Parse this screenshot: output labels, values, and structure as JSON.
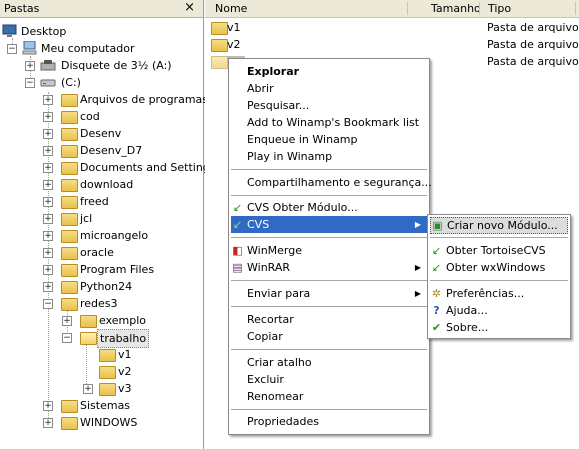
{
  "tree": {
    "header_title": "Pastas",
    "close_glyph": "×",
    "nodes": [
      {
        "label": "Desktop",
        "icon": "desktop-icon",
        "expander": ""
      },
      {
        "label": "Meu computador",
        "icon": "computer-icon",
        "expander": "−"
      },
      {
        "label": "Disquete de 3½ (A:)",
        "icon": "floppy-icon",
        "expander": "+"
      },
      {
        "label": "(C:)",
        "icon": "drive-icon",
        "expander": "−"
      },
      {
        "label": "Arquivos de programas",
        "icon": "folder-icon",
        "expander": "+"
      },
      {
        "label": "cod",
        "icon": "folder-icon",
        "expander": "+"
      },
      {
        "label": "Desenv",
        "icon": "folder-icon",
        "expander": "+"
      },
      {
        "label": "Desenv_D7",
        "icon": "folder-icon",
        "expander": "+"
      },
      {
        "label": "Documents and Settings",
        "icon": "folder-icon",
        "expander": "+"
      },
      {
        "label": "download",
        "icon": "folder-icon",
        "expander": "+"
      },
      {
        "label": "freed",
        "icon": "folder-icon",
        "expander": "+"
      },
      {
        "label": "jcl",
        "icon": "folder-icon",
        "expander": "+"
      },
      {
        "label": "microangelo",
        "icon": "folder-icon",
        "expander": "+"
      },
      {
        "label": "oracle",
        "icon": "folder-icon",
        "expander": "+"
      },
      {
        "label": "Program Files",
        "icon": "folder-icon",
        "expander": "+"
      },
      {
        "label": "Python24",
        "icon": "folder-icon",
        "expander": "+"
      },
      {
        "label": "redes3",
        "icon": "folder-icon",
        "expander": "−"
      },
      {
        "label": "exemplo",
        "icon": "folder-icon",
        "expander": "+"
      },
      {
        "label": "trabalho",
        "icon": "folder-open-icon",
        "expander": "−"
      },
      {
        "label": "v1",
        "icon": "folder-icon",
        "expander": ""
      },
      {
        "label": "v2",
        "icon": "folder-icon",
        "expander": ""
      },
      {
        "label": "v3",
        "icon": "folder-icon",
        "expander": "+"
      },
      {
        "label": "Sistemas",
        "icon": "folder-icon",
        "expander": "+"
      },
      {
        "label": "WINDOWS",
        "icon": "folder-icon",
        "expander": "+"
      }
    ]
  },
  "list": {
    "columns": {
      "name": "Nome",
      "size": "Tamanho",
      "type": "Tipo"
    },
    "rows": [
      {
        "name": "v1",
        "size": "",
        "type": "Pasta de arquivos"
      },
      {
        "name": "v2",
        "size": "",
        "type": "Pasta de arquivos"
      },
      {
        "name": "",
        "size": "",
        "type": "Pasta de arquivos"
      }
    ]
  },
  "context_menu": {
    "items": {
      "explorar": "Explorar",
      "abrir": "Abrir",
      "pesquisar": "Pesquisar...",
      "winamp_bookmark": "Add to Winamp's Bookmark list",
      "enqueue_winamp": "Enqueue in Winamp",
      "play_winamp": "Play in Winamp",
      "compartilhamento": "Compartilhamento e segurança...",
      "cvs_obter": "CVS Obter Módulo...",
      "cvs": "CVS",
      "winmerge": "WinMerge",
      "winrar": "WinRAR",
      "enviar_para": "Enviar para",
      "recortar": "Recortar",
      "copiar": "Copiar",
      "criar_atalho": "Criar atalho",
      "excluir": "Excluir",
      "renomear": "Renomear",
      "propriedades": "Propriedades"
    }
  },
  "cvs_submenu": {
    "items": {
      "criar_modulo": "Criar novo Módulo...",
      "obter_tortoise": "Obter TortoiseCVS",
      "obter_wx": "Obter wxWindows",
      "preferencias": "Preferências...",
      "ajuda": "Ajuda...",
      "sobre": "Sobre..."
    }
  },
  "colors": {
    "highlight": "#316ac5",
    "folder": "#e9c04b",
    "chrome": "#ece9d8"
  }
}
